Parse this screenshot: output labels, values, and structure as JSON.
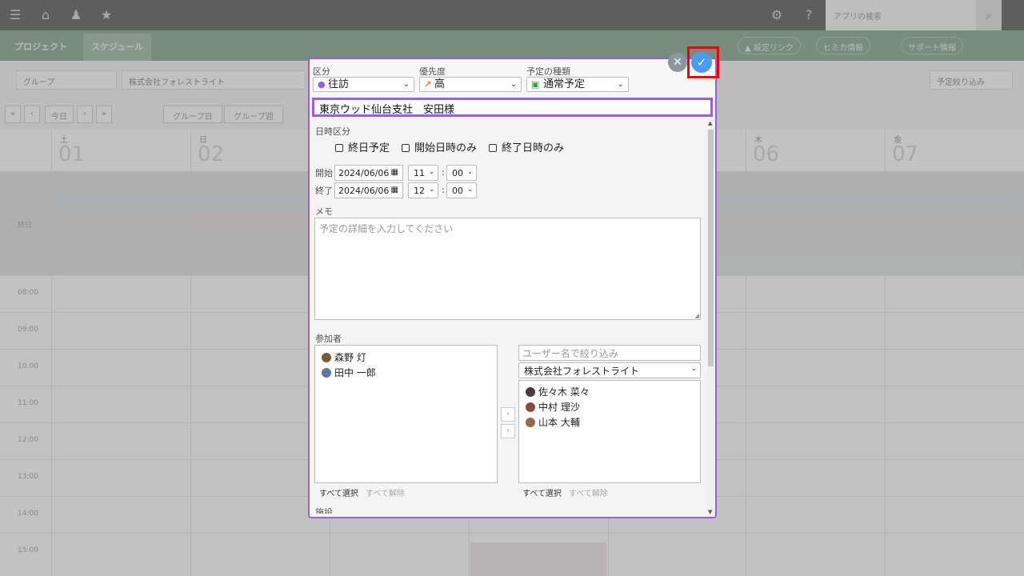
{
  "background": {
    "nav": {
      "project": "プロジェクト",
      "schedule": "スケジュール"
    },
    "nav_right": [
      "▲ 設定リンク",
      "ヒミカ情報",
      "サポート情報"
    ],
    "search_placeholder": "アプリの検索",
    "filter": {
      "group": "グループ",
      "company": "株式会社フォレストライト",
      "button": "予定絞り込み"
    },
    "toolbar": [
      "«",
      "‹",
      "今日",
      "›",
      "»",
      "グループ日",
      "グループ週"
    ],
    "days": [
      {
        "dow": "土",
        "num": "01"
      },
      {
        "dow": "日",
        "num": "02"
      },
      {
        "dow": "木",
        "num": "06"
      },
      {
        "dow": "金",
        "num": "07"
      }
    ],
    "times": [
      "08:00",
      "09:00",
      "10:00",
      "11:00",
      "12:00",
      "13:00",
      "14:00",
      "15:00"
    ],
    "allday_label": "終日"
  },
  "dialog": {
    "category": {
      "label": "区分",
      "value": "往訪",
      "dot_color": "#9b5de5"
    },
    "priority": {
      "label": "優先度",
      "value": "高",
      "arrow_color": "#e8761b"
    },
    "type": {
      "label": "予定の種類",
      "value": "通常予定",
      "icon_color": "#3a9b4a"
    },
    "title": "東京ウッド仙台支社　安田様",
    "datetime": {
      "label": "日時区分",
      "options": [
        "終日予定",
        "開始日時のみ",
        "終了日時のみ"
      ],
      "start_label": "開始",
      "start_date": "2024/06/06",
      "start_hour": "11",
      "start_min": "00",
      "end_label": "終了",
      "end_date": "2024/06/06",
      "end_hour": "12",
      "end_min": "00"
    },
    "memo": {
      "label": "メモ",
      "placeholder": "予定の詳細を入力してください"
    },
    "participants": {
      "label": "参加者",
      "selected": [
        "森野 灯",
        "田中 一郎"
      ],
      "filter_placeholder": "ユーザー名で絞り込み",
      "company": "株式会社フォレストライト",
      "available": [
        "佐々木 菜々",
        "中村 理沙",
        "山本 大輔"
      ],
      "select_all": "すべて選択",
      "deselect_all": "すべて解除"
    },
    "next_section_label": "施設"
  }
}
